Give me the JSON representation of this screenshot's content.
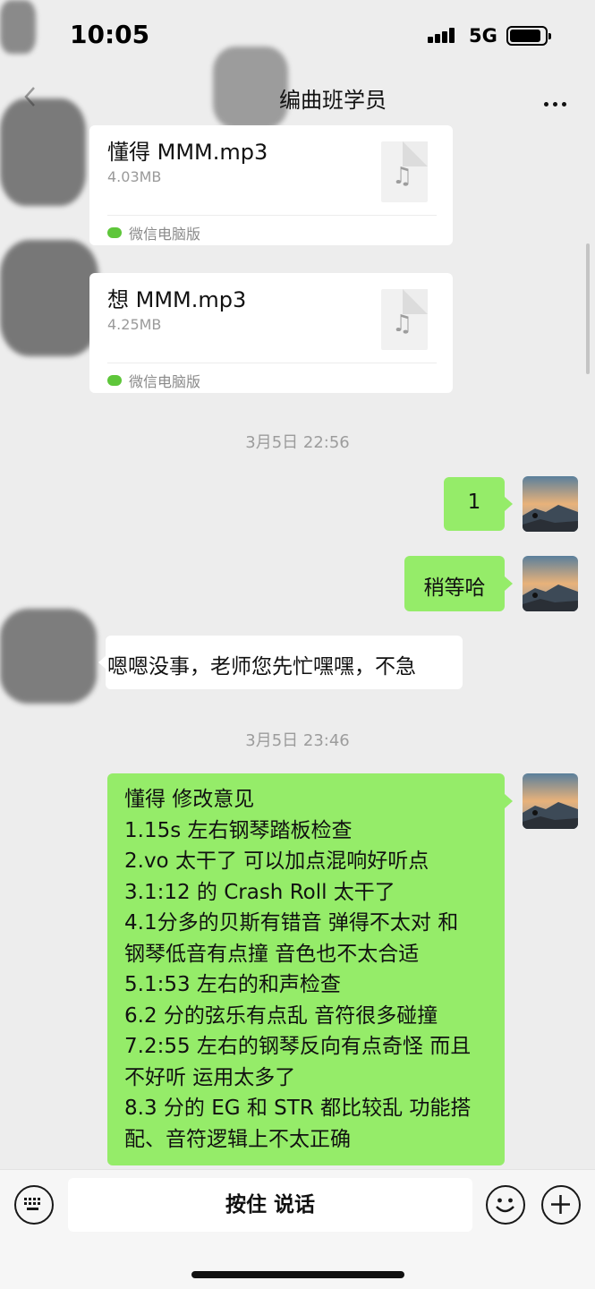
{
  "status_bar": {
    "time": "10:05",
    "network": "5G"
  },
  "nav": {
    "title": "编曲班学员",
    "back_icon": "chevron-left-icon",
    "more_icon": "more-dots-icon"
  },
  "messages": {
    "file1": {
      "name": "懂得 MMM.mp3",
      "size": "4.03MB",
      "source": "微信电脑版"
    },
    "file2": {
      "name": "想 MMM.mp3",
      "size": "4.25MB",
      "source": "微信电脑版"
    },
    "time1": "3月5日 22:56",
    "msg1": "1",
    "msg2": "稍等哈",
    "msg3": "嗯嗯没事，老师您先忙嘿嘿，不急",
    "time2": "3月5日 23:46",
    "feedback_lines": [
      "懂得 修改意见",
      "1.15s 左右钢琴踏板检查",
      "2.vo 太干了 可以加点混响好听点",
      "3.1:12 的 Crash Roll 太干了",
      "4.1分多的贝斯有错音 弹得不太对 和",
      "钢琴低音有点撞 音色也不太合适",
      "5.1:53 左右的和声检查",
      "6.2 分的弦乐有点乱 音符很多碰撞",
      "7.2:55 左右的钢琴反向有点奇怪 而且",
      "不好听 运用太多了",
      "8.3 分的 EG 和 STR 都比较乱 功能搭",
      "配、音符逻辑上不太正确"
    ]
  },
  "input_bar": {
    "hold_to_talk": "按住 说话",
    "keyboard_icon": "keyboard-icon",
    "emoji_icon": "emoji-icon",
    "plus_icon": "plus-icon"
  },
  "colors": {
    "background": "#ededed",
    "sent_bubble": "#95ec69",
    "received_bubble": "#ffffff",
    "timestamp": "#9c9c9c"
  }
}
